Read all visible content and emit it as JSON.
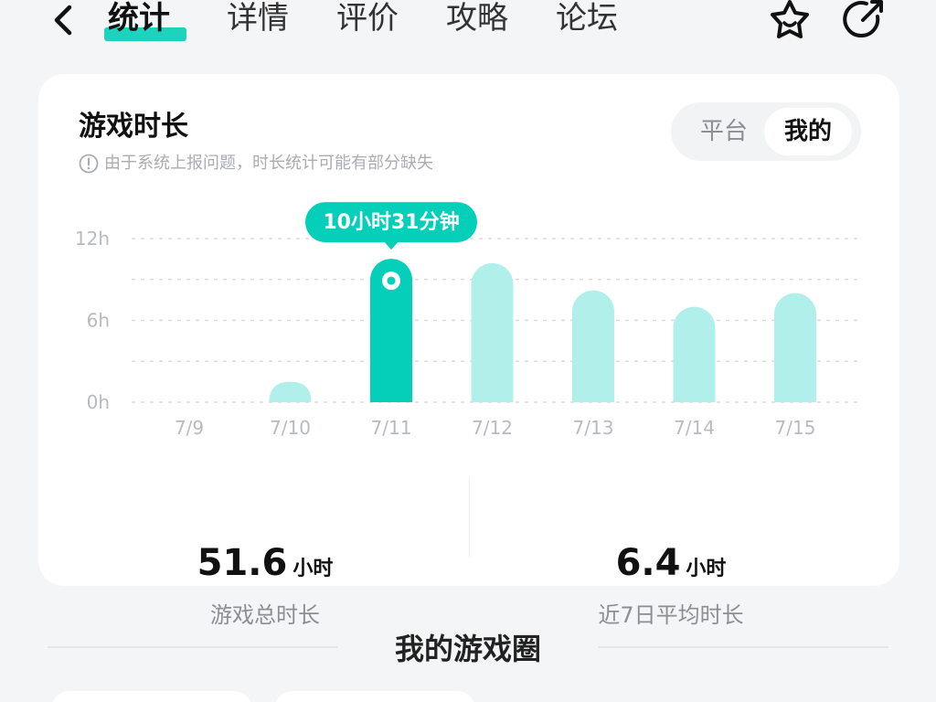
{
  "nav": {
    "tabs": [
      {
        "label": "统计",
        "active": true
      },
      {
        "label": "详情",
        "active": false
      },
      {
        "label": "评价",
        "active": false
      },
      {
        "label": "攻略",
        "active": false
      },
      {
        "label": "论坛",
        "active": false
      }
    ]
  },
  "playtime": {
    "title": "游戏时长",
    "notice": "由于系统上报问题，时长统计可能有部分缺失",
    "toggle": {
      "platform_label": "平台",
      "mine_label": "我的",
      "selected": "我的"
    },
    "stats": {
      "total_value": "51.6",
      "total_unit": "小时",
      "total_label": "游戏总时长",
      "avg_value": "6.4",
      "avg_unit": "小时",
      "avg_label": "近7日平均时长"
    }
  },
  "chart_data": {
    "type": "bar",
    "categories": [
      "7/9",
      "7/10",
      "7/11",
      "7/12",
      "7/13",
      "7/14",
      "7/15"
    ],
    "values": [
      0,
      1.5,
      10.52,
      10.2,
      8.2,
      7.0,
      8.0
    ],
    "y_unit": "hours",
    "ylim": [
      0,
      12
    ],
    "y_ticks": [
      {
        "value": 0,
        "label": "0h"
      },
      {
        "value": 6,
        "label": "6h"
      },
      {
        "value": 12,
        "label": "12h"
      }
    ],
    "grid_values": [
      0,
      3,
      6,
      9,
      12
    ],
    "highlight_index": 2,
    "tooltip": "10小时31分钟",
    "colors": {
      "bar": "#b1f0ea",
      "highlight": "#06cfb9",
      "grid": "#d9dcdf",
      "tick": "#b7bbbf"
    }
  },
  "section": {
    "title": "我的游戏圈"
  }
}
